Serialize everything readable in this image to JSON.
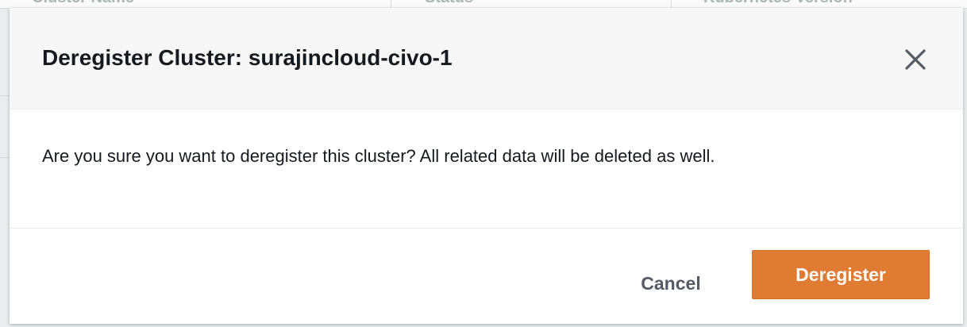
{
  "background": {
    "columns": [
      "Cluster Name",
      "Status",
      "Kubernetes Version"
    ]
  },
  "dialog": {
    "title": "Deregister Cluster: surajincloud-civo-1",
    "close_icon": "close-icon",
    "message": "Are you sure you want to deregister this cluster? All related data will be deleted as well.",
    "cancel_label": "Cancel",
    "confirm_label": "Deregister"
  },
  "colors": {
    "primary_button": "#e07b33",
    "title_text": "#16191f",
    "cancel_text": "#545b64"
  }
}
